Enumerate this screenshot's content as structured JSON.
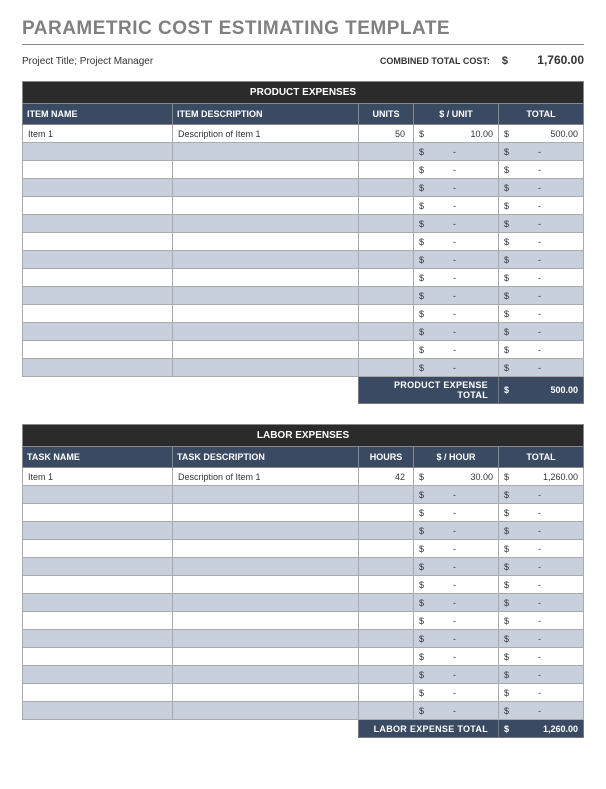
{
  "title": "PARAMETRIC COST ESTIMATING TEMPLATE",
  "project_line": "Project Title; Project Manager",
  "combined_label": "COMBINED TOTAL COST:",
  "currency": "$",
  "combined_total": "1,760.00",
  "sections": [
    {
      "title": "PRODUCT EXPENSES",
      "headers": [
        "ITEM NAME",
        "ITEM DESCRIPTION",
        "UNITS",
        "$ / UNIT",
        "TOTAL"
      ],
      "rows": [
        {
          "name": "Item 1",
          "desc": "Description of Item 1",
          "units": "50",
          "rate": "10.00",
          "total": "500.00"
        },
        {
          "name": "",
          "desc": "",
          "units": "",
          "rate": "-",
          "total": "-"
        },
        {
          "name": "",
          "desc": "",
          "units": "",
          "rate": "-",
          "total": "-"
        },
        {
          "name": "",
          "desc": "",
          "units": "",
          "rate": "-",
          "total": "-"
        },
        {
          "name": "",
          "desc": "",
          "units": "",
          "rate": "-",
          "total": "-"
        },
        {
          "name": "",
          "desc": "",
          "units": "",
          "rate": "-",
          "total": "-"
        },
        {
          "name": "",
          "desc": "",
          "units": "",
          "rate": "-",
          "total": "-"
        },
        {
          "name": "",
          "desc": "",
          "units": "",
          "rate": "-",
          "total": "-"
        },
        {
          "name": "",
          "desc": "",
          "units": "",
          "rate": "-",
          "total": "-"
        },
        {
          "name": "",
          "desc": "",
          "units": "",
          "rate": "-",
          "total": "-"
        },
        {
          "name": "",
          "desc": "",
          "units": "",
          "rate": "-",
          "total": "-"
        },
        {
          "name": "",
          "desc": "",
          "units": "",
          "rate": "-",
          "total": "-"
        },
        {
          "name": "",
          "desc": "",
          "units": "",
          "rate": "-",
          "total": "-"
        },
        {
          "name": "",
          "desc": "",
          "units": "",
          "rate": "-",
          "total": "-"
        }
      ],
      "total_label": "PRODUCT EXPENSE TOTAL",
      "total_value": "500.00"
    },
    {
      "title": "LABOR EXPENSES",
      "headers": [
        "TASK NAME",
        "TASK DESCRIPTION",
        "HOURS",
        "$ / HOUR",
        "TOTAL"
      ],
      "rows": [
        {
          "name": "Item 1",
          "desc": "Description of Item 1",
          "units": "42",
          "rate": "30.00",
          "total": "1,260.00"
        },
        {
          "name": "",
          "desc": "",
          "units": "",
          "rate": "-",
          "total": "-"
        },
        {
          "name": "",
          "desc": "",
          "units": "",
          "rate": "-",
          "total": "-"
        },
        {
          "name": "",
          "desc": "",
          "units": "",
          "rate": "-",
          "total": "-"
        },
        {
          "name": "",
          "desc": "",
          "units": "",
          "rate": "-",
          "total": "-"
        },
        {
          "name": "",
          "desc": "",
          "units": "",
          "rate": "-",
          "total": "-"
        },
        {
          "name": "",
          "desc": "",
          "units": "",
          "rate": "-",
          "total": "-"
        },
        {
          "name": "",
          "desc": "",
          "units": "",
          "rate": "-",
          "total": "-"
        },
        {
          "name": "",
          "desc": "",
          "units": "",
          "rate": "-",
          "total": "-"
        },
        {
          "name": "",
          "desc": "",
          "units": "",
          "rate": "-",
          "total": "-"
        },
        {
          "name": "",
          "desc": "",
          "units": "",
          "rate": "-",
          "total": "-"
        },
        {
          "name": "",
          "desc": "",
          "units": "",
          "rate": "-",
          "total": "-"
        },
        {
          "name": "",
          "desc": "",
          "units": "",
          "rate": "-",
          "total": "-"
        },
        {
          "name": "",
          "desc": "",
          "units": "",
          "rate": "-",
          "total": "-"
        }
      ],
      "total_label": "LABOR EXPENSE TOTAL",
      "total_value": "1,260.00"
    }
  ]
}
